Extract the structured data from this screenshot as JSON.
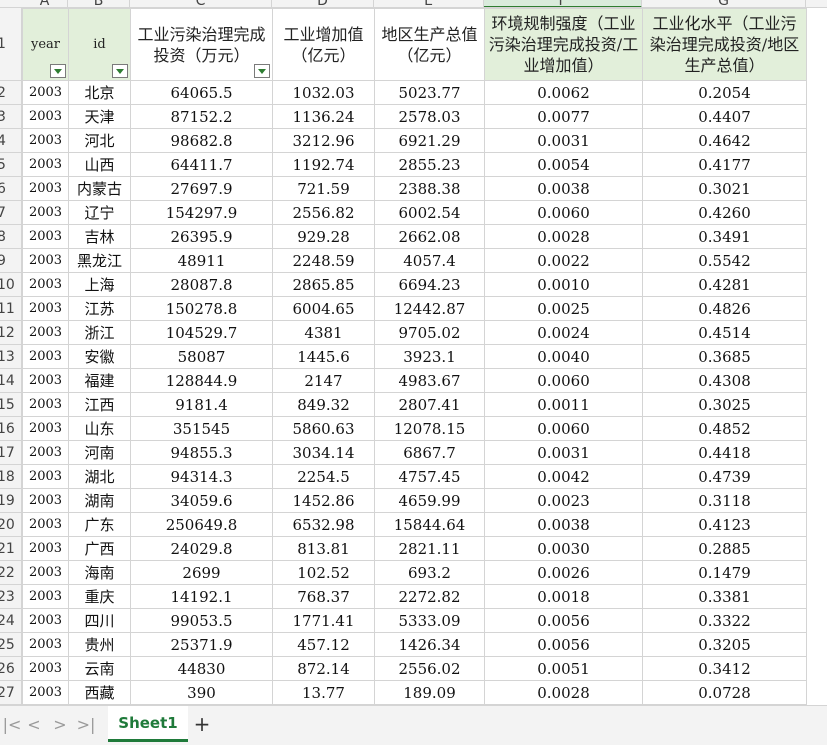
{
  "columns": [
    "A",
    "B",
    "C",
    "D",
    "E",
    "F",
    "G"
  ],
  "headers": {
    "year": "year",
    "id": "id",
    "invest": "工业污染治理完成投资（万元）",
    "industry": "工业增加值（亿元）",
    "gdp": "地区生产总值（亿元）",
    "regulation": "环境规制强度（工业污染治理完成投资/工业增加值）",
    "industrialization": "工业化水平（工业污染治理完成投资/地区生产总值）"
  },
  "rows": [
    {
      "n": "2",
      "year": "2003",
      "id": "北京",
      "invest": "64065.5",
      "industry": "1032.03",
      "gdp": "5023.77",
      "regulation": "0.0062",
      "industrialization": "0.2054"
    },
    {
      "n": "3",
      "year": "2003",
      "id": "天津",
      "invest": "87152.2",
      "industry": "1136.24",
      "gdp": "2578.03",
      "regulation": "0.0077",
      "industrialization": "0.4407"
    },
    {
      "n": "4",
      "year": "2003",
      "id": "河北",
      "invest": "98682.8",
      "industry": "3212.96",
      "gdp": "6921.29",
      "regulation": "0.0031",
      "industrialization": "0.4642"
    },
    {
      "n": "5",
      "year": "2003",
      "id": "山西",
      "invest": "64411.7",
      "industry": "1192.74",
      "gdp": "2855.23",
      "regulation": "0.0054",
      "industrialization": "0.4177"
    },
    {
      "n": "6",
      "year": "2003",
      "id": "内蒙古",
      "invest": "27697.9",
      "industry": "721.59",
      "gdp": "2388.38",
      "regulation": "0.0038",
      "industrialization": "0.3021"
    },
    {
      "n": "7",
      "year": "2003",
      "id": "辽宁",
      "invest": "154297.9",
      "industry": "2556.82",
      "gdp": "6002.54",
      "regulation": "0.0060",
      "industrialization": "0.4260"
    },
    {
      "n": "8",
      "year": "2003",
      "id": "吉林",
      "invest": "26395.9",
      "industry": "929.28",
      "gdp": "2662.08",
      "regulation": "0.0028",
      "industrialization": "0.3491"
    },
    {
      "n": "9",
      "year": "2003",
      "id": "黑龙江",
      "invest": "48911",
      "industry": "2248.59",
      "gdp": "4057.4",
      "regulation": "0.0022",
      "industrialization": "0.5542"
    },
    {
      "n": "10",
      "year": "2003",
      "id": "上海",
      "invest": "28087.8",
      "industry": "2865.85",
      "gdp": "6694.23",
      "regulation": "0.0010",
      "industrialization": "0.4281"
    },
    {
      "n": "11",
      "year": "2003",
      "id": "江苏",
      "invest": "150278.8",
      "industry": "6004.65",
      "gdp": "12442.87",
      "regulation": "0.0025",
      "industrialization": "0.4826"
    },
    {
      "n": "12",
      "year": "2003",
      "id": "浙江",
      "invest": "104529.7",
      "industry": "4381",
      "gdp": "9705.02",
      "regulation": "0.0024",
      "industrialization": "0.4514"
    },
    {
      "n": "13",
      "year": "2003",
      "id": "安徽",
      "invest": "58087",
      "industry": "1445.6",
      "gdp": "3923.1",
      "regulation": "0.0040",
      "industrialization": "0.3685"
    },
    {
      "n": "14",
      "year": "2003",
      "id": "福建",
      "invest": "128844.9",
      "industry": "2147",
      "gdp": "4983.67",
      "regulation": "0.0060",
      "industrialization": "0.4308"
    },
    {
      "n": "15",
      "year": "2003",
      "id": "江西",
      "invest": "9181.4",
      "industry": "849.32",
      "gdp": "2807.41",
      "regulation": "0.0011",
      "industrialization": "0.3025"
    },
    {
      "n": "16",
      "year": "2003",
      "id": "山东",
      "invest": "351545",
      "industry": "5860.63",
      "gdp": "12078.15",
      "regulation": "0.0060",
      "industrialization": "0.4852"
    },
    {
      "n": "17",
      "year": "2003",
      "id": "河南",
      "invest": "94855.3",
      "industry": "3034.14",
      "gdp": "6867.7",
      "regulation": "0.0031",
      "industrialization": "0.4418"
    },
    {
      "n": "18",
      "year": "2003",
      "id": "湖北",
      "invest": "94314.3",
      "industry": "2254.5",
      "gdp": "4757.45",
      "regulation": "0.0042",
      "industrialization": "0.4739"
    },
    {
      "n": "19",
      "year": "2003",
      "id": "湖南",
      "invest": "34059.6",
      "industry": "1452.86",
      "gdp": "4659.99",
      "regulation": "0.0023",
      "industrialization": "0.3118"
    },
    {
      "n": "20",
      "year": "2003",
      "id": "广东",
      "invest": "250649.8",
      "industry": "6532.98",
      "gdp": "15844.64",
      "regulation": "0.0038",
      "industrialization": "0.4123"
    },
    {
      "n": "21",
      "year": "2003",
      "id": "广西",
      "invest": "24029.8",
      "industry": "813.81",
      "gdp": "2821.11",
      "regulation": "0.0030",
      "industrialization": "0.2885"
    },
    {
      "n": "22",
      "year": "2003",
      "id": "海南",
      "invest": "2699",
      "industry": "102.52",
      "gdp": "693.2",
      "regulation": "0.0026",
      "industrialization": "0.1479"
    },
    {
      "n": "23",
      "year": "2003",
      "id": "重庆",
      "invest": "14192.1",
      "industry": "768.37",
      "gdp": "2272.82",
      "regulation": "0.0018",
      "industrialization": "0.3381"
    },
    {
      "n": "24",
      "year": "2003",
      "id": "四川",
      "invest": "99053.5",
      "industry": "1771.41",
      "gdp": "5333.09",
      "regulation": "0.0056",
      "industrialization": "0.3322"
    },
    {
      "n": "25",
      "year": "2003",
      "id": "贵州",
      "invest": "25371.9",
      "industry": "457.12",
      "gdp": "1426.34",
      "regulation": "0.0056",
      "industrialization": "0.3205"
    },
    {
      "n": "26",
      "year": "2003",
      "id": "云南",
      "invest": "44830",
      "industry": "872.14",
      "gdp": "2556.02",
      "regulation": "0.0051",
      "industrialization": "0.3412"
    },
    {
      "n": "27",
      "year": "2003",
      "id": "西藏",
      "invest": "390",
      "industry": "13.77",
      "gdp": "189.09",
      "regulation": "0.0028",
      "industrialization": "0.0728"
    }
  ],
  "header_row_num": "1",
  "sheet_tabs": [
    {
      "label": "Sheet1",
      "active": true
    }
  ],
  "nav": {
    "first": "|<",
    "prev": "<",
    "next": ">",
    "last": ">|",
    "add": "+"
  },
  "colors": {
    "accent": "#1f7a3a",
    "header_fill": "#e2efda",
    "grid_line": "#d4d4d4"
  }
}
